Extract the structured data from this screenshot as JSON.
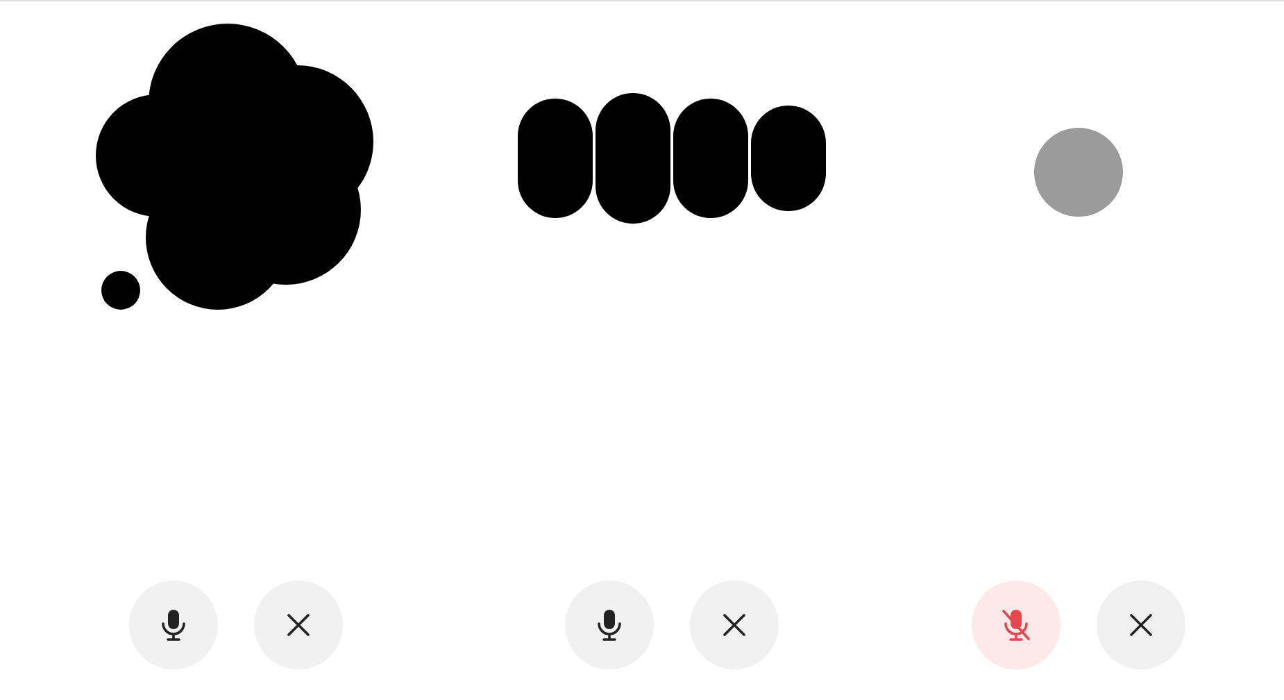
{
  "panels": [
    {
      "kind": "thinking",
      "muted": false
    },
    {
      "kind": "speaking",
      "muted": false
    },
    {
      "kind": "idle",
      "muted": true
    }
  ]
}
